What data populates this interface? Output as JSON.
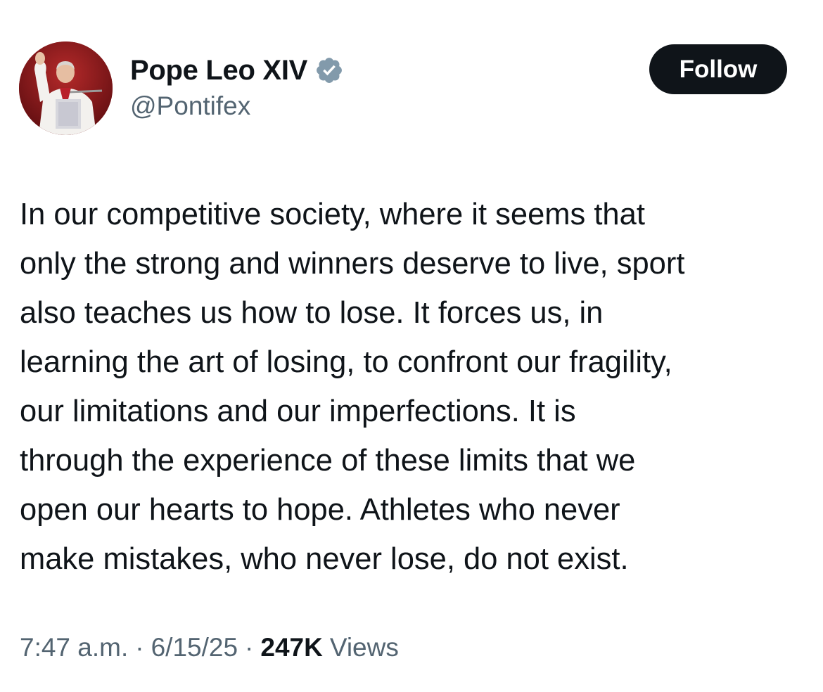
{
  "author": {
    "display_name": "Pope Leo XIV",
    "handle": "@Pontifex",
    "verified_color": "#829aab"
  },
  "follow_button": {
    "label": "Follow"
  },
  "tweet": {
    "lines": [
      "In our competitive society, where it seems that",
      "only the strong and winners deserve to live, sport",
      "also teaches us how to lose. It forces us, in",
      "learning the art of losing, to confront our fragility,",
      "our limitations and our imperfections. It is",
      "through the experience of these limits that we",
      "open our hearts to hope. Athletes who never",
      "make mistakes, who never lose, do not exist."
    ]
  },
  "meta": {
    "time": "7:47 a.m.",
    "separator": "·",
    "date": "6/15/25",
    "views_count": "247K",
    "views_label": "Views"
  },
  "colors": {
    "text_primary": "#0f1419",
    "text_secondary": "#536471",
    "button_bg": "#0f1419",
    "button_text": "#ffffff"
  }
}
